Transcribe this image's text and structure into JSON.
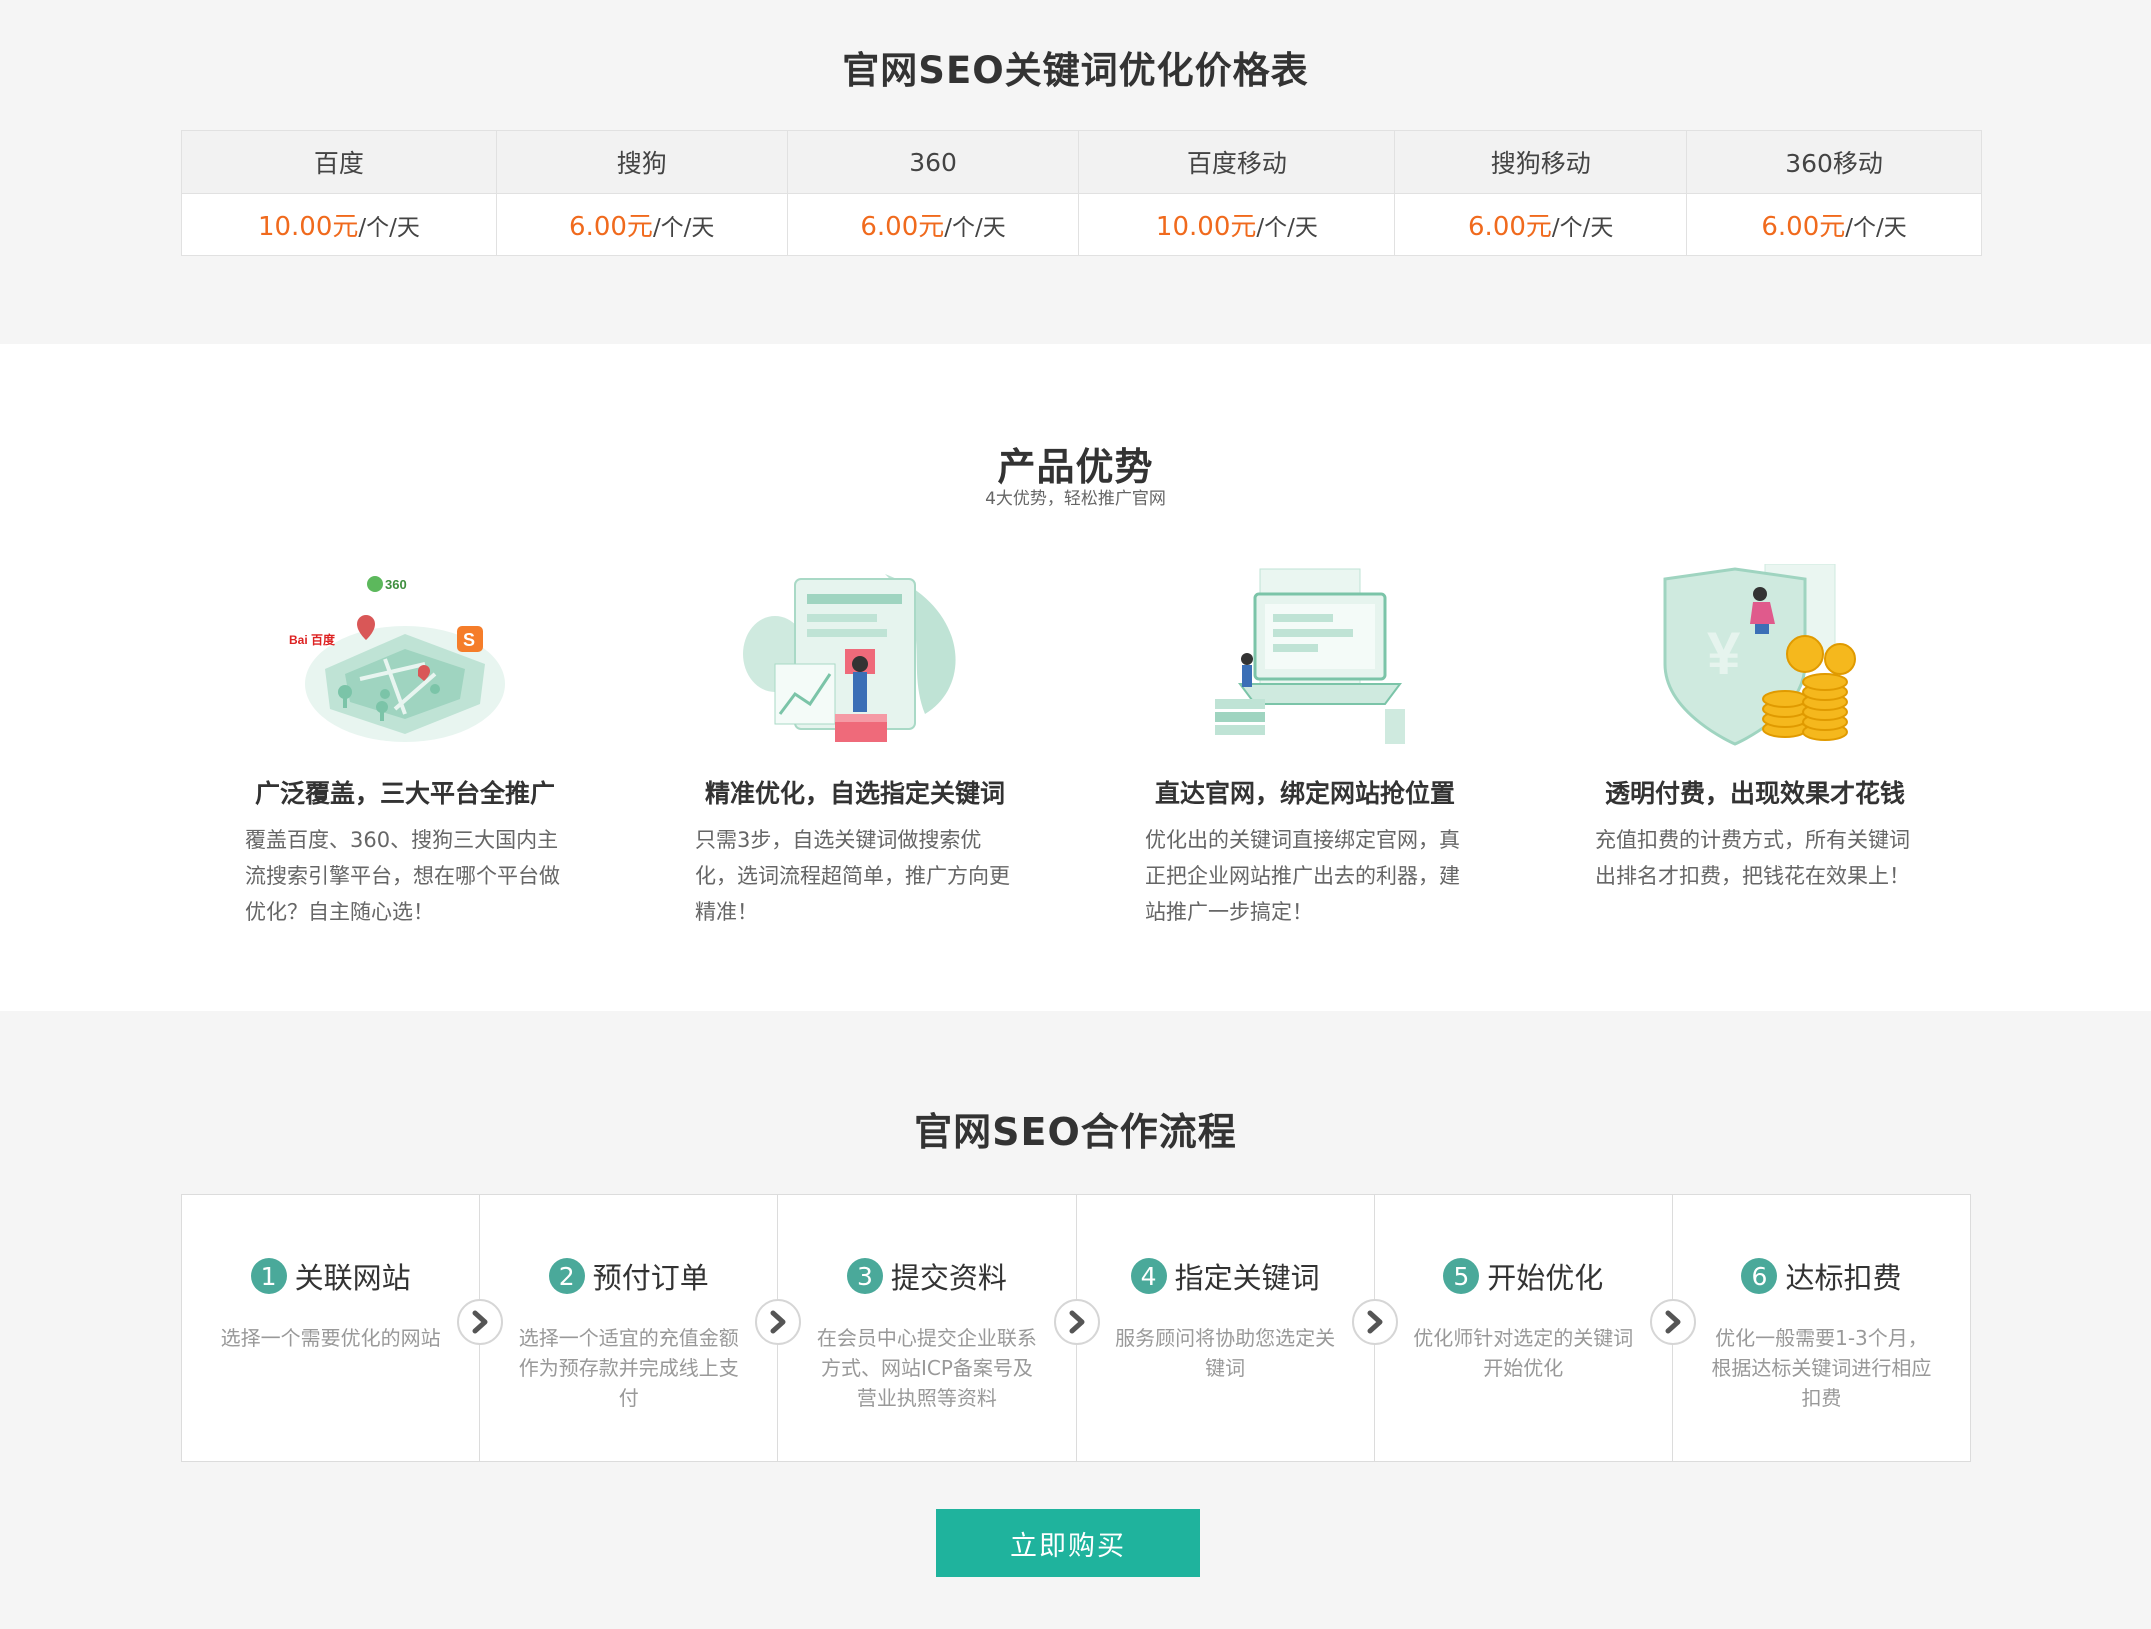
{
  "price_section": {
    "title": "官网SEO关键词优化价格表",
    "columns": [
      "百度",
      "搜狗",
      "360",
      "百度移动",
      "搜狗移动",
      "360移动"
    ],
    "prices": [
      {
        "amount": "10.00元",
        "unit": "/个/天"
      },
      {
        "amount": "6.00元",
        "unit": "/个/天"
      },
      {
        "amount": "6.00元",
        "unit": "/个/天"
      },
      {
        "amount": "10.00元",
        "unit": "/个/天"
      },
      {
        "amount": "6.00元",
        "unit": "/个/天"
      },
      {
        "amount": "6.00元",
        "unit": "/个/天"
      }
    ],
    "price_color": "#f06a1d"
  },
  "advantages": {
    "title": "产品优势",
    "subtitle": "4大优势，轻松推广官网",
    "items": [
      {
        "heading": "广泛覆盖，三大平台全推广",
        "desc": "覆盖百度、360、搜狗三大国内主流搜索引擎平台，想在哪个平台做优化？自主随心选！",
        "icon": "map-platforms-illustration",
        "logo_texts": [
          "360",
          "Bai 百度",
          "S"
        ]
      },
      {
        "heading": "精准优化，自选指定关键词",
        "desc": "只需3步，自选关键词做搜索优化，选词流程超简单，推广方向更精准！",
        "icon": "precise-keyword-illustration"
      },
      {
        "heading": "直达官网，绑定网站抢位置",
        "desc": "优化出的关键词直接绑定官网，真正把企业网站推广出去的利器，建站推广一步搞定！",
        "icon": "laptop-website-illustration"
      },
      {
        "heading": "透明付费，出现效果才花钱",
        "desc": "充值扣费的计费方式，所有关键词出排名才扣费，把钱花在效果上！",
        "icon": "coins-shield-illustration"
      }
    ]
  },
  "flow": {
    "title": "官网SEO合作流程",
    "steps": [
      {
        "num": "1",
        "label": "关联网站",
        "desc": "选择一个需要优化的网站"
      },
      {
        "num": "2",
        "label": "预付订单",
        "desc": "选择一个适宜的充值金额作为预存款并完成线上支付"
      },
      {
        "num": "3",
        "label": "提交资料",
        "desc": "在会员中心提交企业联系方式、网站ICP备案号及营业执照等资料"
      },
      {
        "num": "4",
        "label": "指定关键词",
        "desc": "服务顾问将协助您选定关键词"
      },
      {
        "num": "5",
        "label": "开始优化",
        "desc": "优化师针对选定的关键词开始优化"
      },
      {
        "num": "6",
        "label": "达标扣费",
        "desc": "优化一般需要1-3个月，根据达标关键词进行相应扣费"
      }
    ],
    "arrow_icon": "chevron-right-icon",
    "buy_label": "立即购买",
    "accent": "#1fb39d"
  }
}
